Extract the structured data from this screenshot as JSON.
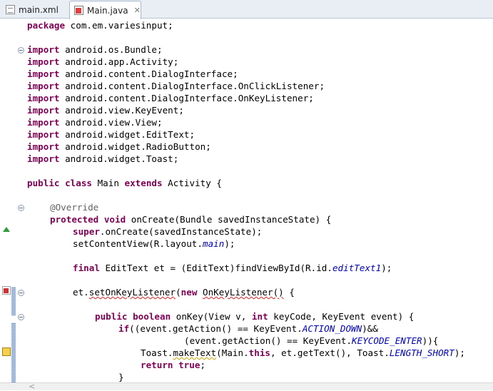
{
  "tabs": [
    {
      "label": "main.xml",
      "icon": "xml-file-icon"
    },
    {
      "label": "Main.java",
      "icon": "java-file-icon",
      "close": "✕"
    }
  ],
  "code": {
    "line1": [
      "package com.em.variesinput;"
    ],
    "imports": [
      "android.os.Bundle;",
      "android.app.Activity;",
      "android.content.DialogInterface;",
      "android.content.DialogInterface.OnClickListener;",
      "android.content.DialogInterface.OnKeyListener;",
      "android.view.KeyEvent;",
      "android.view.View;",
      "android.widget.EditText;",
      "android.widget.RadioButton;",
      "android.widget.Toast;"
    ],
    "kw_import": "import",
    "kw_package": "package",
    "package_name": " com.em.variesinput;",
    "class_line": {
      "kw_public": "public",
      "kw_class": "class",
      "name": " Main ",
      "kw_extends": "extends",
      "rest": " Activity {"
    },
    "override": "@Override",
    "oncreate": {
      "kw_protected": "protected",
      "kw_void": "void",
      "rest": " onCreate(Bundle savedInstanceState) {"
    },
    "super_line": {
      "kw_super": "super",
      "rest": ".onCreate(savedInstanceState);"
    },
    "setcontent": {
      "pre": "setContentView(R.layout.",
      "field": "main",
      "post": ");"
    },
    "final_line": {
      "kw_final": "final",
      "pre": " EditText et = (EditText)findViewById(R.id.",
      "field": "editText1",
      "post": ");"
    },
    "listener_line": {
      "pre": "et.",
      "err1": "setOnKeyListener",
      "mid": "(",
      "kw_new": "new",
      "sp": " ",
      "err2": "OnKeyListener()",
      "post": " {"
    },
    "onkey_line": {
      "kw_public": "public",
      "kw_boolean": "boolean",
      "pre": " onKey(View v, ",
      "kw_int": "int",
      "post": " keyCode, KeyEvent event) {"
    },
    "if_line": {
      "kw_if": "if",
      "pre": "((event.getAction() == KeyEvent.",
      "field": "ACTION_DOWN",
      "post": ")&&"
    },
    "cond_line": {
      "pre": "(event.getAction() == KeyEvent.",
      "field": "KEYCODE_ENTER",
      "post": ")){"
    },
    "toast_line": {
      "pre": "Toast.",
      "warn1": "makeText",
      "mid1": "(Main.",
      "kw_this": "this",
      "mid2": ", et.getText(), Toast.",
      "field": "LENGTH_SHORT",
      "post": ");"
    },
    "return_line": {
      "kw_return": "return",
      "sp": " ",
      "kw_true": "true",
      "post": ";"
    },
    "close_brace": "}"
  },
  "scroll": {
    "left_arrow": "<"
  },
  "colors": {
    "keyword": "#7f0055",
    "field": "#0000c0",
    "annotation": "#646464"
  }
}
